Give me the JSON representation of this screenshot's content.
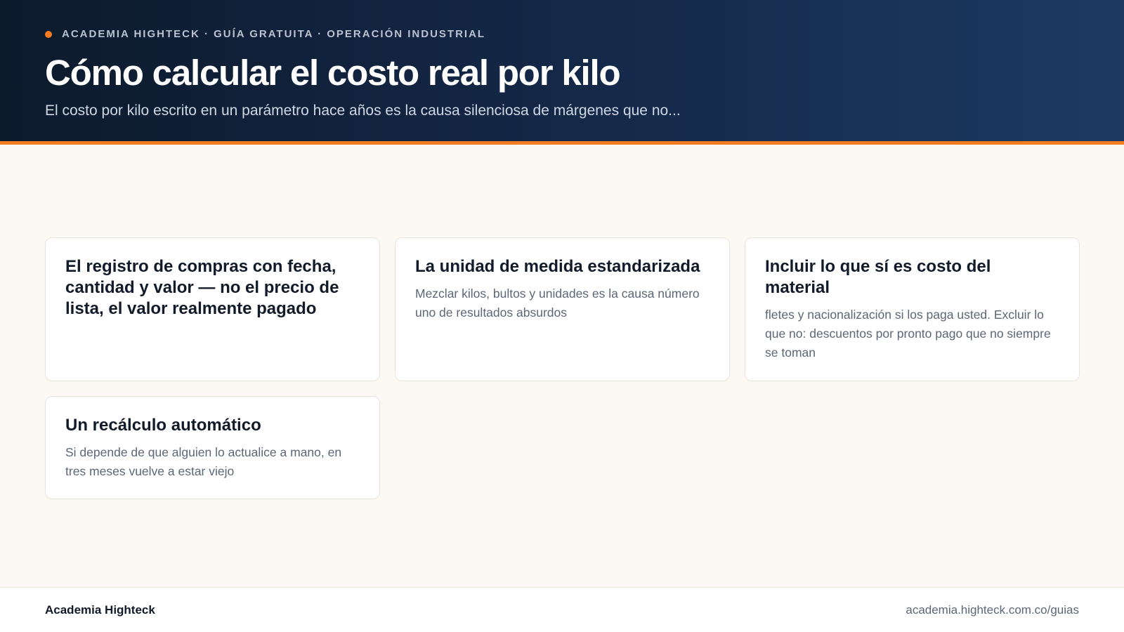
{
  "header": {
    "eyebrow": "ACADEMIA HIGHTECK · GUÍA GRATUITA · OPERACIÓN INDUSTRIAL",
    "title": "Cómo calcular el costo real por kilo",
    "subtitle": "El costo por kilo escrito en un parámetro hace años es la causa silenciosa de márgenes que no..."
  },
  "cards": [
    {
      "title": "El registro de compras con fecha, cantidad y valor — no el precio de lista, el valor realmente pagado",
      "body": ""
    },
    {
      "title": "La unidad de medida estandarizada",
      "body": "Mezclar kilos, bultos y unidades es la causa número uno de resultados absurdos"
    },
    {
      "title": "Incluir lo que sí es costo del material",
      "body": "fletes y nacionalización si los paga usted. Excluir lo que no: descuentos por pronto pago que no siempre se toman"
    },
    {
      "title": "Un recálculo automático",
      "body": "Si depende de que alguien lo actualice a mano, en tres meses vuelve a estar viejo"
    }
  ],
  "footer": {
    "brand": "Academia Highteck",
    "url": "academia.highteck.com.co/guias"
  },
  "colors": {
    "accent": "#f47c20",
    "header_bg": "#15294a",
    "page_bg": "#fcf8f4"
  }
}
